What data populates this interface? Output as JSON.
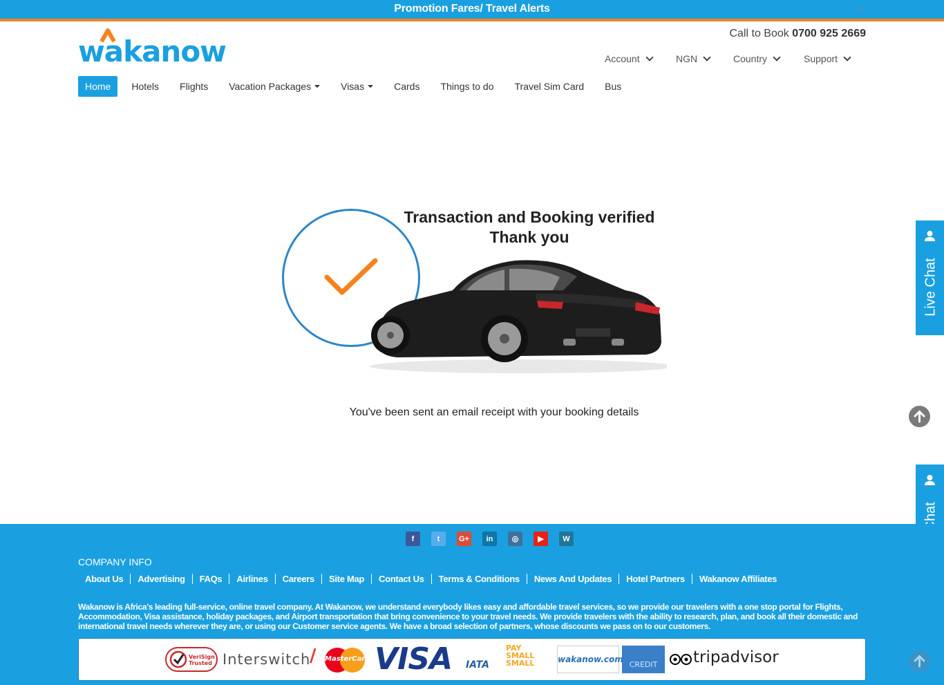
{
  "promo": {
    "text": "Promotion Fares/ Travel Alerts",
    "close": "×"
  },
  "header": {
    "logo_text": "wakanow",
    "call_label": "Call to Book",
    "phone": "0700 925 2669",
    "top_nav": [
      "Account",
      "NGN",
      "Country",
      "Support"
    ]
  },
  "nav": {
    "items": [
      "Home",
      "Hotels",
      "Flights",
      "Vacation Packages",
      "Visas",
      "Cards",
      "Things to do",
      "Travel Sim Card",
      "Bus"
    ],
    "active": "Home"
  },
  "main": {
    "title_line1": "Transaction and Booking verified",
    "title_line2": "Thank you",
    "receipt_text": "You've been sent an email receipt with your booking details"
  },
  "live_chat": {
    "label": "Live Chat"
  },
  "footer": {
    "socials": [
      {
        "name": "facebook",
        "glyph": "f",
        "color": "#3b5998"
      },
      {
        "name": "twitter",
        "glyph": "t",
        "color": "#55acee"
      },
      {
        "name": "google-plus",
        "glyph": "G+",
        "color": "#dd4b39"
      },
      {
        "name": "linkedin",
        "glyph": "in",
        "color": "#0e76a8"
      },
      {
        "name": "instagram",
        "glyph": "◎",
        "color": "#3f729b"
      },
      {
        "name": "youtube",
        "glyph": "▶",
        "color": "#e62117"
      },
      {
        "name": "wordpress",
        "glyph": "W",
        "color": "#21759b"
      }
    ],
    "company_title": "COMPANY INFO",
    "links": [
      "About Us",
      "Advertising",
      "FAQs",
      "Airlines",
      "Careers",
      "Site Map",
      "Contact Us",
      "Terms & Conditions",
      "News And Updates",
      "Hotel Partners",
      "Wakanow Affiliates"
    ],
    "about": "Wakanow is Africa's leading full-service, online travel company. At Wakanow, we understand everybody likes easy and affordable travel services, so we provide our travelers with a one stop portal for Flights, Accommodation, Visa assistance, holiday packages, and Airport transportation that bring convenience to your travel needs. We provide travelers with the ability to research, plan, and book all their domestic and international travel needs wherever they are, or using our Customer service agents. We have a broad selection of partners, whose discounts we pass on to our customers.",
    "partners": {
      "verisign": "VeriSign Trusted",
      "interswitch": "Interswitch",
      "mastercard": "MasterCard",
      "visa": "VISA",
      "iata": "IATA",
      "paysmallsmall": "PAY SMALL SMALL",
      "wakanow_com": "wakanow.com",
      "credit": "CREDIT",
      "tripadvisor": "tripadvisor"
    }
  },
  "colors": {
    "brand_blue": "#1aa0e0",
    "orange": "#f5821f",
    "circle_blue": "#2a86c8"
  }
}
